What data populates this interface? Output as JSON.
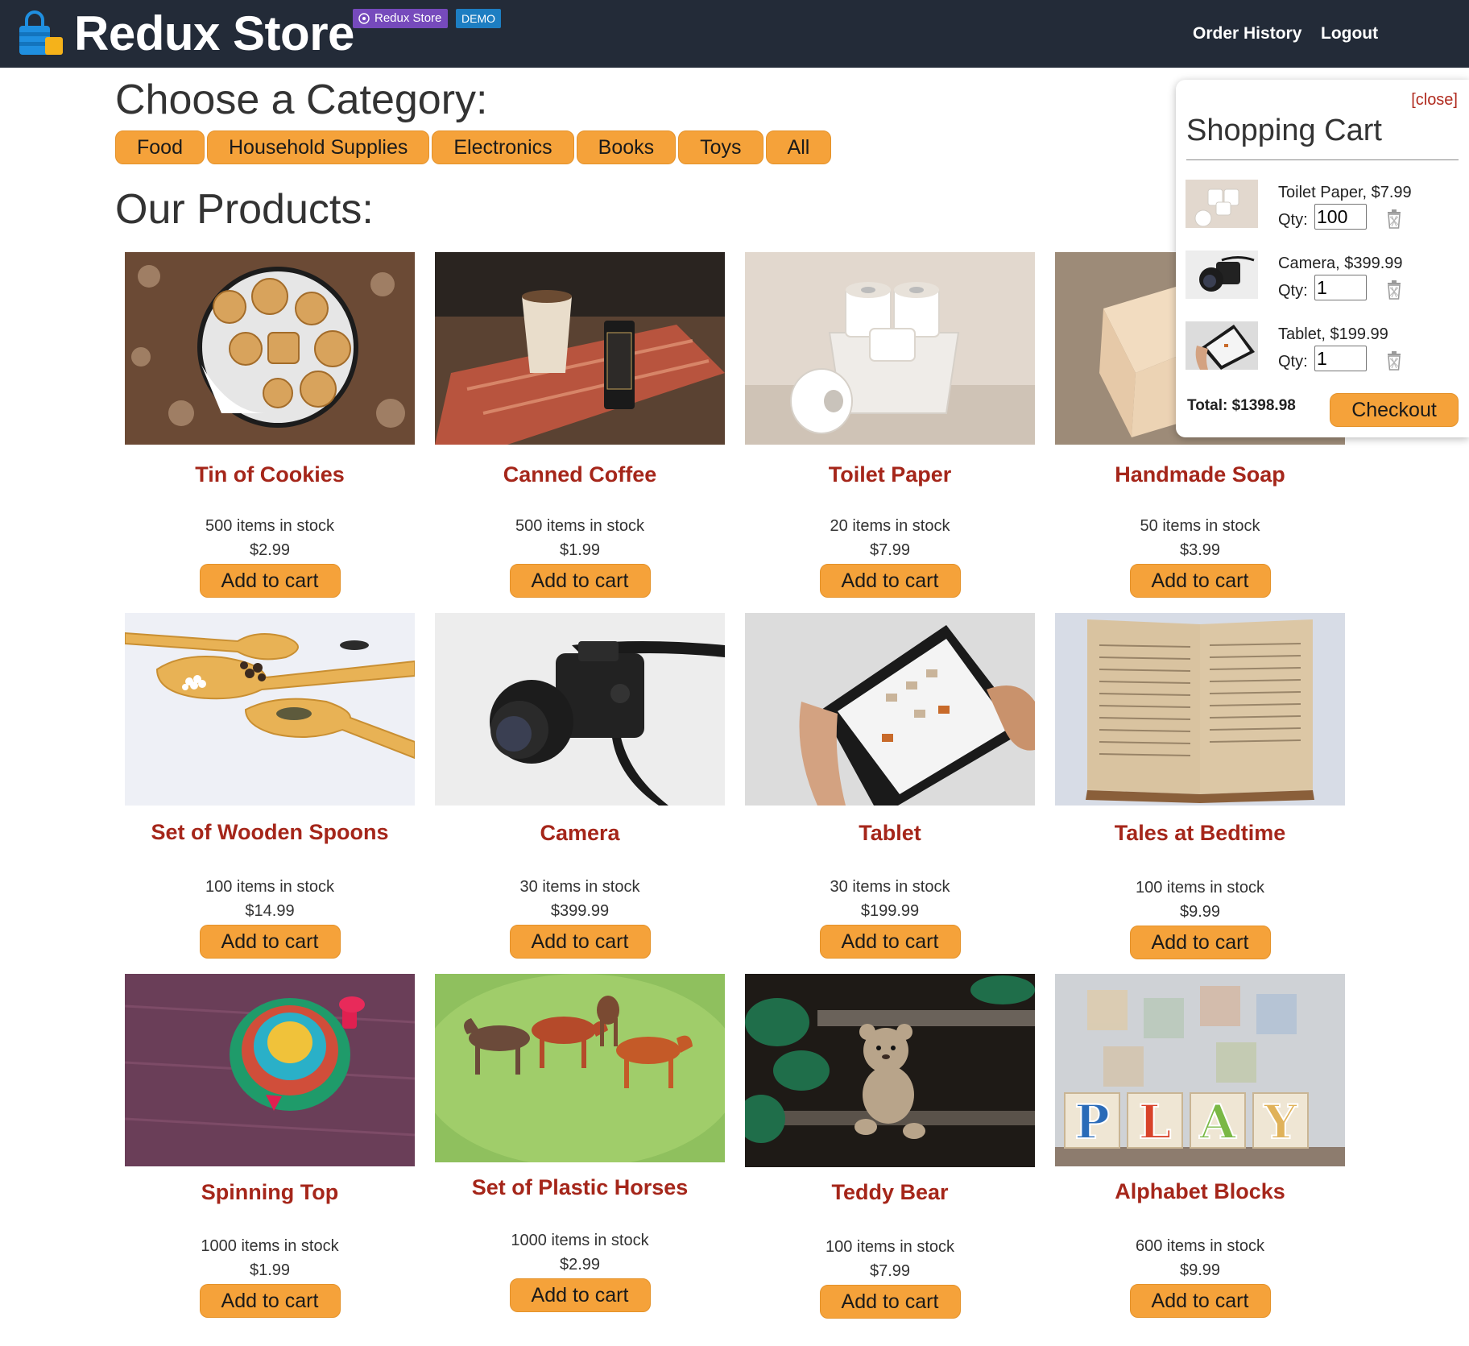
{
  "header": {
    "brand": "Redux Store",
    "badge_redux": "Redux Store",
    "badge_demo": "DEMO",
    "nav": {
      "order_history": "Order History",
      "logout": "Logout"
    }
  },
  "categories": {
    "title": "Choose a Category:",
    "items": [
      "Food",
      "Household Supplies",
      "Electronics",
      "Books",
      "Toys",
      "All"
    ]
  },
  "products": {
    "title": "Our Products:",
    "add_label": "Add to cart",
    "items": [
      {
        "name": "Tin of Cookies",
        "stock": "500 items in stock",
        "price": "$2.99"
      },
      {
        "name": "Canned Coffee",
        "stock": "500 items in stock",
        "price": "$1.99"
      },
      {
        "name": "Toilet Paper",
        "stock": "20 items in stock",
        "price": "$7.99"
      },
      {
        "name": "Handmade Soap",
        "stock": "50 items in stock",
        "price": "$3.99"
      },
      {
        "name": "Set of Wooden Spoons",
        "stock": "100 items in stock",
        "price": "$14.99"
      },
      {
        "name": "Camera",
        "stock": "30 items in stock",
        "price": "$399.99"
      },
      {
        "name": "Tablet",
        "stock": "30 items in stock",
        "price": "$199.99"
      },
      {
        "name": "Tales at Bedtime",
        "stock": "100 items in stock",
        "price": "$9.99"
      },
      {
        "name": "Spinning Top",
        "stock": "1000 items in stock",
        "price": "$1.99"
      },
      {
        "name": "Set of Plastic Horses",
        "stock": "1000 items in stock",
        "price": "$2.99"
      },
      {
        "name": "Teddy Bear",
        "stock": "100 items in stock",
        "price": "$7.99"
      },
      {
        "name": "Alphabet Blocks",
        "stock": "600 items in stock",
        "price": "$9.99"
      }
    ]
  },
  "cart": {
    "close_label": "[close]",
    "title": "Shopping Cart",
    "qty_label": "Qty:",
    "items": [
      {
        "label": "Toilet Paper, $7.99",
        "qty": "100"
      },
      {
        "label": "Camera, $399.99",
        "qty": "1"
      },
      {
        "label": "Tablet, $199.99",
        "qty": "1"
      }
    ],
    "total": "Total: $1398.98",
    "checkout_label": "Checkout"
  },
  "colors": {
    "header_bg": "#232b38",
    "accent_button": "#f5a23a",
    "product_name": "#a5261a",
    "redux_badge": "#764abc",
    "demo_badge": "#1d7ec2"
  }
}
